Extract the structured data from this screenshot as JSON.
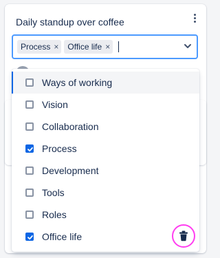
{
  "card": {
    "title": "Daily standup over coffee"
  },
  "tag_select": {
    "selected_tags": [
      {
        "label": "Process",
        "remove_glyph": "×"
      },
      {
        "label": "Office life",
        "remove_glyph": "×"
      }
    ],
    "dropdown_icon": "chevron-down-icon",
    "focus_color": "#4c9aff"
  },
  "menu": {
    "options": [
      {
        "label": "Ways of working",
        "checked": false,
        "focused": true
      },
      {
        "label": "Vision",
        "checked": false,
        "focused": false
      },
      {
        "label": "Collaboration",
        "checked": false,
        "focused": false
      },
      {
        "label": "Process",
        "checked": true,
        "focused": false
      },
      {
        "label": "Development",
        "checked": false,
        "focused": false
      },
      {
        "label": "Tools",
        "checked": false,
        "focused": false
      },
      {
        "label": "Roles",
        "checked": false,
        "focused": false
      },
      {
        "label": "Office life",
        "checked": true,
        "focused": false
      }
    ],
    "checked_color": "#0c66e4"
  },
  "actions": {
    "more_icon": "more-vertical-icon",
    "delete_icon": "trash-icon",
    "highlight_color": "#ff3df0"
  }
}
